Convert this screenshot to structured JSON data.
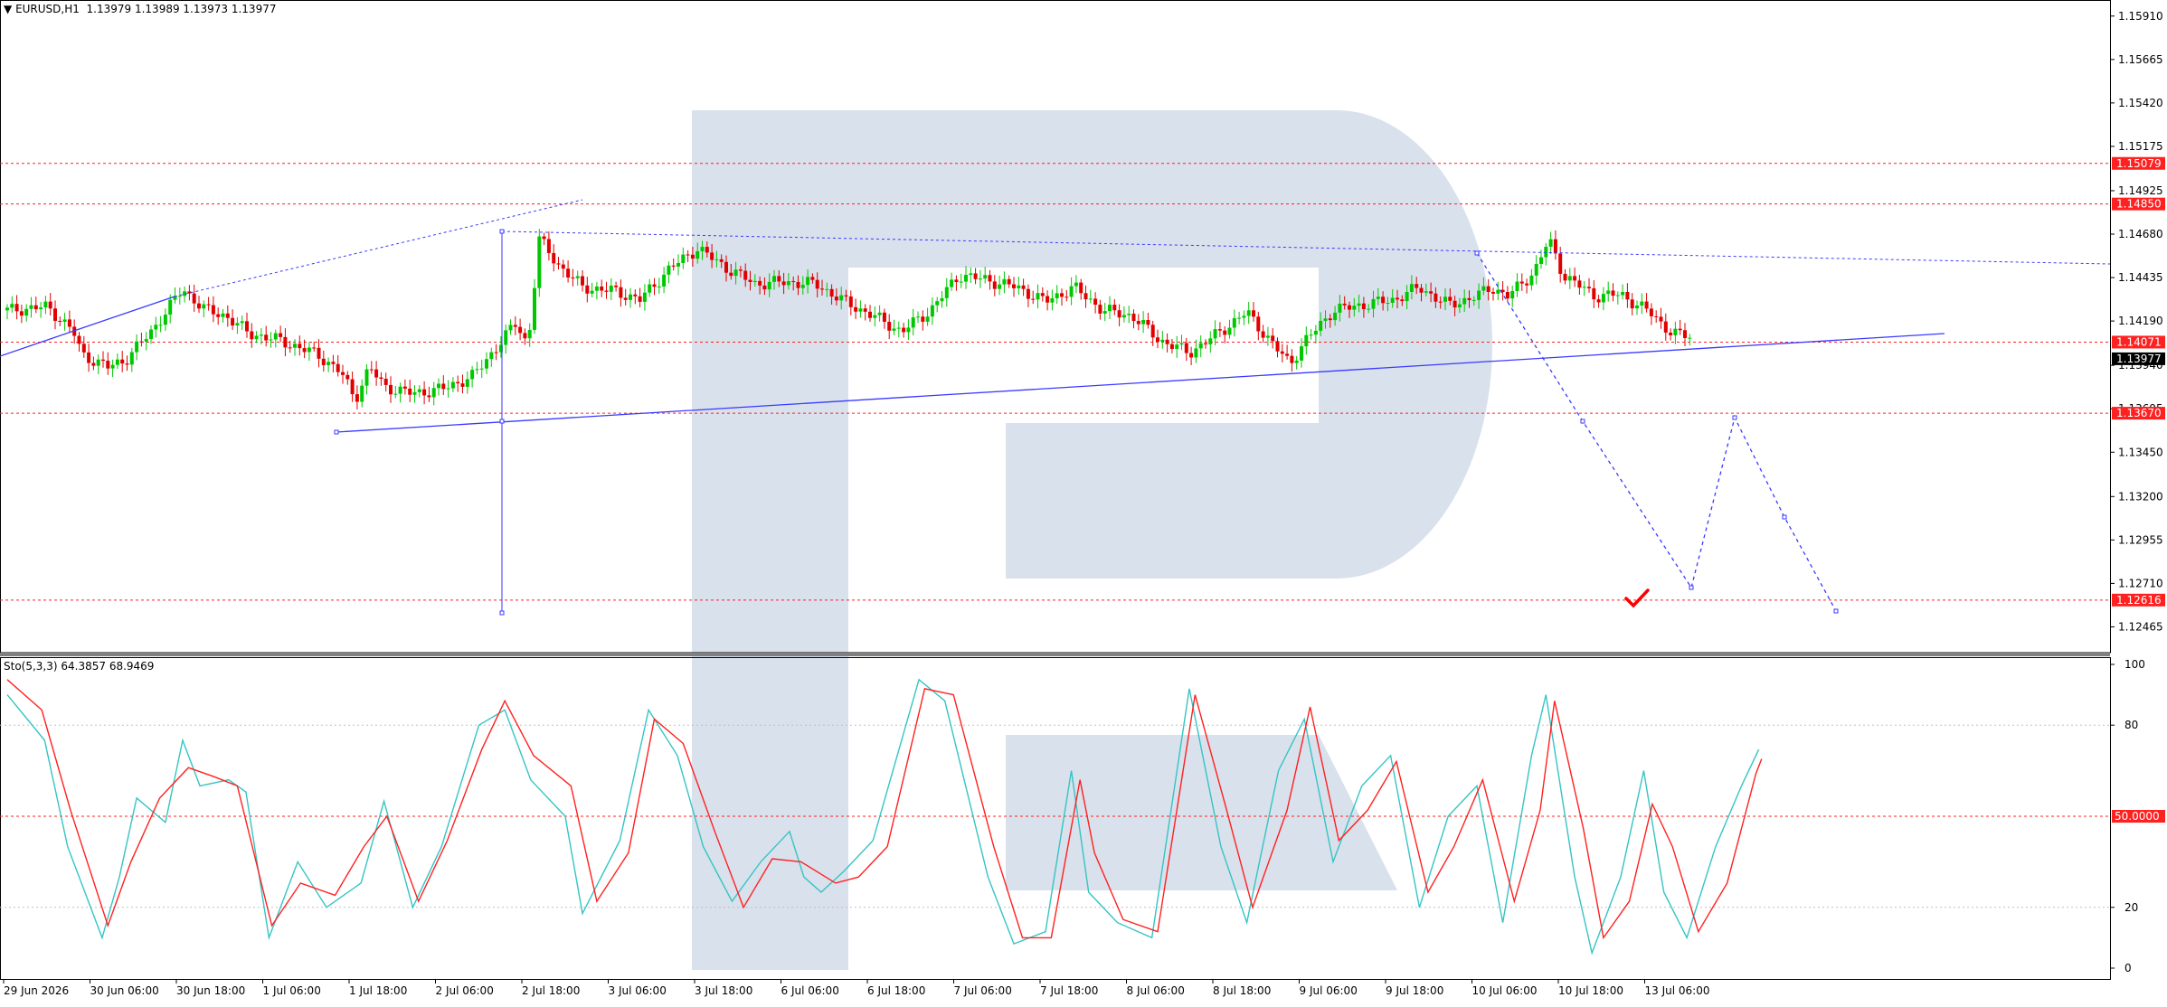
{
  "header": {
    "symbol": "EURUSD,H1",
    "ohlc": "1.13979 1.13989 1.13973 1.13977"
  },
  "oscillator": {
    "label": "Sto(5,3,3) 64.3857 68.9469",
    "levels": [
      "100",
      "80",
      "50.0000",
      "20",
      "0"
    ]
  },
  "colors": {
    "bull": "#00c800",
    "bear": "#e00000",
    "trendline": "#3a3aff",
    "hline": "#ff2020",
    "k_line": "#35c4c4",
    "d_line": "#ff2020",
    "watermark": "#d9e1ec"
  },
  "chart_data": [
    {
      "type": "candlestick",
      "ylim": [
        1.1235,
        1.1597
      ],
      "y_ticks": [
        "1.15910",
        "1.15665",
        "1.15420",
        "1.15175",
        "1.14925",
        "1.14680",
        "1.14435",
        "1.14190",
        "1.13940",
        "1.13695",
        "1.13450",
        "1.13200",
        "1.12955",
        "1.12710",
        "1.12465"
      ],
      "x_ticks": [
        "29 Jun 2026",
        "30 Jun 06:00",
        "30 Jun 18:00",
        "1 Jul 06:00",
        "1 Jul 18:00",
        "2 Jul 06:00",
        "2 Jul 18:00",
        "3 Jul 06:00",
        "3 Jul 18:00",
        "6 Jul 06:00",
        "6 Jul 18:00",
        "7 Jul 06:00",
        "7 Jul 18:00",
        "8 Jul 06:00",
        "8 Jul 18:00",
        "9 Jul 06:00",
        "9 Jul 18:00",
        "10 Jul 06:00",
        "10 Jul 18:00",
        "13 Jul 06:00"
      ],
      "price_levels": [
        {
          "label": "1.15079",
          "value": 1.15079
        },
        {
          "label": "1.14850",
          "value": 1.1485
        },
        {
          "label": "1.14071",
          "value": 1.14071
        },
        {
          "label": "1.13670",
          "value": 1.1367
        },
        {
          "label": "1.12616",
          "value": 1.12616
        }
      ],
      "current_price": {
        "label": "1.13977",
        "value": 1.13977
      },
      "close_path": [
        [
          0,
          1.1425
        ],
        [
          1.4,
          1.1427
        ],
        [
          2.3,
          1.1413
        ],
        [
          2.6,
          1.14
        ],
        [
          3.5,
          1.1393
        ],
        [
          4.1,
          1.1397
        ],
        [
          5.0,
          1.1413
        ],
        [
          6.1,
          1.1437
        ],
        [
          6.9,
          1.1425
        ],
        [
          7.6,
          1.1422
        ],
        [
          8.4,
          1.1412
        ],
        [
          9.5,
          1.1408
        ],
        [
          10.8,
          1.14
        ],
        [
          11.6,
          1.139
        ],
        [
          12.1,
          1.1375
        ],
        [
          12.6,
          1.1393
        ],
        [
          13.1,
          1.1382
        ],
        [
          14.1,
          1.1378
        ],
        [
          15.2,
          1.1381
        ],
        [
          16.2,
          1.1388
        ],
        [
          17.2,
          1.1408
        ],
        [
          17.7,
          1.1418
        ],
        [
          18.1,
          1.1405
        ],
        [
          18.5,
          1.1465
        ],
        [
          19.2,
          1.145
        ],
        [
          20.0,
          1.1438
        ],
        [
          21.1,
          1.1436
        ],
        [
          22.0,
          1.1431
        ],
        [
          23.0,
          1.1448
        ],
        [
          24.0,
          1.146
        ],
        [
          25.0,
          1.1449
        ],
        [
          26.0,
          1.144
        ],
        [
          27.0,
          1.1441
        ],
        [
          28.1,
          1.144
        ],
        [
          29.1,
          1.143
        ],
        [
          30.1,
          1.1422
        ],
        [
          31.1,
          1.1413
        ],
        [
          32.1,
          1.1425
        ],
        [
          33.1,
          1.1445
        ],
        [
          34.1,
          1.1442
        ],
        [
          35.1,
          1.1438
        ],
        [
          36.1,
          1.143
        ],
        [
          37.1,
          1.1438
        ],
        [
          38.1,
          1.1425
        ],
        [
          39.1,
          1.1422
        ],
        [
          40.1,
          1.1408
        ],
        [
          41.1,
          1.1401
        ],
        [
          42.1,
          1.1412
        ],
        [
          43.1,
          1.1424
        ],
        [
          44.1,
          1.1404
        ],
        [
          44.6,
          1.1395
        ],
        [
          45.1,
          1.1407
        ],
        [
          46.1,
          1.1425
        ],
        [
          47.1,
          1.1428
        ],
        [
          48.2,
          1.1431
        ],
        [
          49.1,
          1.1438
        ],
        [
          50.1,
          1.1428
        ],
        [
          51.1,
          1.1433
        ],
        [
          51.6,
          1.1438
        ],
        [
          52.2,
          1.1433
        ],
        [
          53.1,
          1.1447
        ],
        [
          53.6,
          1.1465
        ],
        [
          54.1,
          1.1445
        ],
        [
          55.2,
          1.1433
        ],
        [
          56.1,
          1.1434
        ],
        [
          57.1,
          1.1424
        ],
        [
          57.9,
          1.1412
        ],
        [
          58.6,
          1.141
        ]
      ]
    },
    {
      "type": "line",
      "ylim": [
        0,
        100
      ],
      "series": [
        {
          "name": "",
          "color": "k_line",
          "points": [
            [
              0,
              90
            ],
            [
              1.3,
              75
            ],
            [
              2.1,
              40
            ],
            [
              3.3,
              10
            ],
            [
              3.9,
              30
            ],
            [
              4.5,
              56
            ],
            [
              5.5,
              48
            ],
            [
              6.1,
              75
            ],
            [
              6.7,
              60
            ],
            [
              7.7,
              62
            ],
            [
              8.3,
              58
            ],
            [
              9.1,
              10
            ],
            [
              10.1,
              35
            ],
            [
              11.1,
              20
            ],
            [
              12.3,
              28
            ],
            [
              13.1,
              55
            ],
            [
              14.1,
              20
            ],
            [
              15.1,
              40
            ],
            [
              16.4,
              80
            ],
            [
              17.3,
              85
            ],
            [
              18.2,
              62
            ],
            [
              19.4,
              50
            ],
            [
              20.0,
              18
            ],
            [
              21.3,
              42
            ],
            [
              22.3,
              85
            ],
            [
              23.3,
              70
            ],
            [
              24.2,
              40
            ],
            [
              25.2,
              22
            ],
            [
              26.2,
              35
            ],
            [
              27.2,
              45
            ],
            [
              27.7,
              30
            ],
            [
              28.3,
              25
            ],
            [
              29.1,
              32
            ],
            [
              30.1,
              42
            ],
            [
              31.7,
              95
            ],
            [
              32.6,
              88
            ],
            [
              34.1,
              30
            ],
            [
              35.0,
              8
            ],
            [
              36.1,
              12
            ],
            [
              37.0,
              65
            ],
            [
              37.6,
              25
            ],
            [
              38.6,
              15
            ],
            [
              39.8,
              10
            ],
            [
              41.1,
              92
            ],
            [
              42.2,
              40
            ],
            [
              43.1,
              15
            ],
            [
              44.2,
              65
            ],
            [
              45.1,
              82
            ],
            [
              46.1,
              35
            ],
            [
              47.1,
              60
            ],
            [
              48.1,
              70
            ],
            [
              49.1,
              20
            ],
            [
              50.1,
              50
            ],
            [
              51.1,
              60
            ],
            [
              52.0,
              15
            ],
            [
              53.0,
              70
            ],
            [
              53.5,
              90
            ],
            [
              54.5,
              30
            ],
            [
              55.1,
              5
            ],
            [
              56.1,
              30
            ],
            [
              56.9,
              65
            ],
            [
              57.6,
              25
            ],
            [
              58.4,
              10
            ],
            [
              59.4,
              40
            ],
            [
              60.3,
              60
            ],
            [
              60.9,
              72
            ]
          ]
        },
        {
          "name": "",
          "color": "d_line",
          "points": [
            [
              0,
              95
            ],
            [
              1.2,
              85
            ],
            [
              2.2,
              52
            ],
            [
              3.5,
              14
            ],
            [
              4.3,
              35
            ],
            [
              5.3,
              56
            ],
            [
              6.3,
              66
            ],
            [
              7.2,
              63
            ],
            [
              8.0,
              60
            ],
            [
              9.2,
              14
            ],
            [
              10.2,
              28
            ],
            [
              11.4,
              24
            ],
            [
              12.4,
              40
            ],
            [
              13.2,
              50
            ],
            [
              14.3,
              22
            ],
            [
              15.3,
              42
            ],
            [
              16.5,
              72
            ],
            [
              17.3,
              88
            ],
            [
              18.3,
              70
            ],
            [
              19.6,
              60
            ],
            [
              20.5,
              22
            ],
            [
              21.6,
              38
            ],
            [
              22.5,
              82
            ],
            [
              23.5,
              74
            ],
            [
              24.6,
              45
            ],
            [
              25.6,
              20
            ],
            [
              26.6,
              36
            ],
            [
              27.6,
              35
            ],
            [
              28.8,
              28
            ],
            [
              29.6,
              30
            ],
            [
              30.6,
              40
            ],
            [
              31.9,
              92
            ],
            [
              32.9,
              90
            ],
            [
              34.3,
              40
            ],
            [
              35.3,
              10
            ],
            [
              36.3,
              10
            ],
            [
              37.3,
              62
            ],
            [
              37.8,
              38
            ],
            [
              38.8,
              16
            ],
            [
              40.0,
              12
            ],
            [
              41.3,
              90
            ],
            [
              42.4,
              52
            ],
            [
              43.3,
              20
            ],
            [
              44.5,
              52
            ],
            [
              45.3,
              86
            ],
            [
              46.3,
              42
            ],
            [
              47.3,
              52
            ],
            [
              48.3,
              68
            ],
            [
              49.4,
              25
            ],
            [
              50.3,
              40
            ],
            [
              51.3,
              62
            ],
            [
              52.4,
              22
            ],
            [
              53.3,
              52
            ],
            [
              53.8,
              88
            ],
            [
              54.8,
              46
            ],
            [
              55.5,
              10
            ],
            [
              56.4,
              22
            ],
            [
              57.2,
              54
            ],
            [
              57.9,
              40
            ],
            [
              58.8,
              12
            ],
            [
              59.8,
              28
            ],
            [
              60.8,
              64
            ],
            [
              61.0,
              68.9
            ]
          ]
        }
      ]
    }
  ]
}
